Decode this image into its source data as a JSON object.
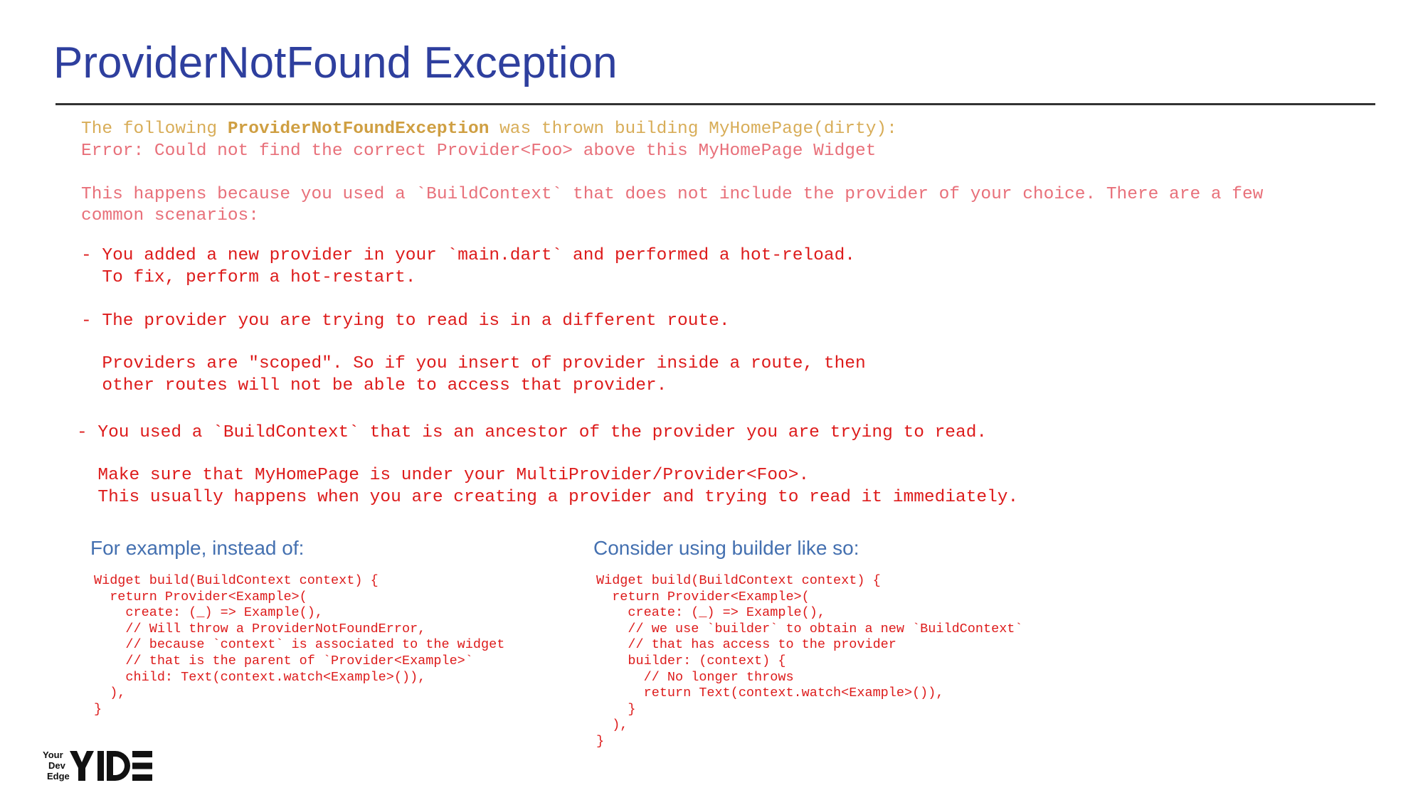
{
  "slide": {
    "title": "ProviderNotFound Exception"
  },
  "error_header": {
    "line1_prefix": "The following ",
    "line1_exception": "ProviderNotFoundException",
    "line1_suffix": " was thrown building MyHomePage(dirty):",
    "line2": "Error: Could not find the correct Provider<Foo> above this MyHomePage Widget"
  },
  "explanation": {
    "line1": "This happens because you used a `BuildContext` that does not include the provider of your choice. There are a few",
    "line2": "common scenarios:"
  },
  "scenarios": {
    "s1_line1": "- You added a new provider in your `main.dart` and performed a hot-reload.",
    "s1_line2": "  To fix, perform a hot-restart.",
    "s2_line1": "- The provider you are trying to read is in a different route.",
    "s2_line2": "  Providers are \"scoped\". So if you insert of provider inside a route, then",
    "s2_line3": "  other routes will not be able to access that provider.",
    "s3_line1": "- You used a `BuildContext` that is an ancestor of the provider you are trying to read.",
    "s3_line2": "  Make sure that MyHomePage is under your MultiProvider/Provider<Foo>.",
    "s3_line3": "  This usually happens when you are creating a provider and trying to read it immediately."
  },
  "left_example": {
    "heading": "For example, instead of:",
    "code": "Widget build(BuildContext context) {\n  return Provider<Example>(\n    create: (_) => Example(),\n    // Will throw a ProviderNotFoundError,\n    // because `context` is associated to the widget\n    // that is the parent of `Provider<Example>`\n    child: Text(context.watch<Example>()),\n  ),\n}"
  },
  "right_example": {
    "heading": "Consider using builder like so:",
    "code": "Widget build(BuildContext context) {\n  return Provider<Example>(\n    create: (_) => Example(),\n    // we use `builder` to obtain a new `BuildContext`\n    // that has access to the provider\n    builder: (context) {\n      // No longer throws\n      return Text(context.watch<Example>()),\n    }\n  ),\n}"
  },
  "logo": {
    "line1": "Your",
    "line2": "Dev",
    "line3": "Edge",
    "mark": "YDE"
  },
  "colors": {
    "title": "#2e3f9e",
    "header_text": "#d8ad58",
    "explanation_text": "#e8707a",
    "scenario_text": "#dd1b1b",
    "subheading": "#4470b0",
    "rule": "#333333"
  }
}
